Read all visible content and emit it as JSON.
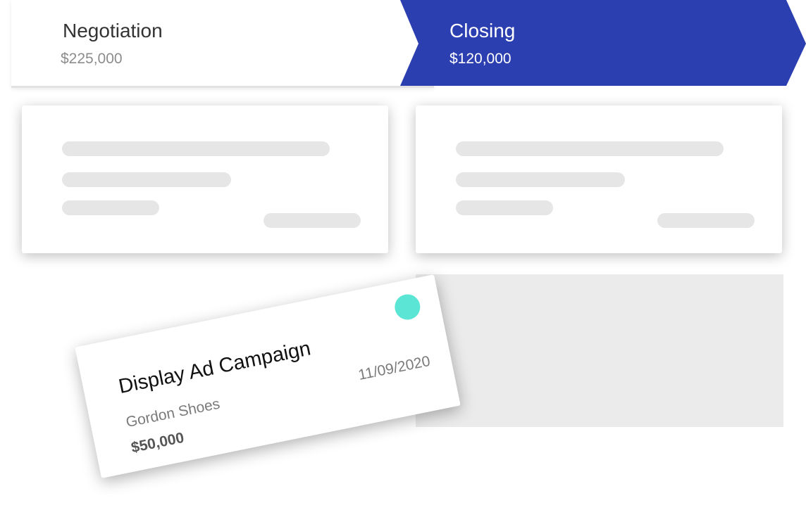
{
  "pipeline": {
    "stages": [
      {
        "name": "Negotiation",
        "amount": "$225,000"
      },
      {
        "name": "Closing",
        "amount": "$120,000"
      }
    ],
    "active_color": "#2c3fb1"
  },
  "deal_card": {
    "title": "Display Ad Campaign",
    "company": "Gordon Shoes",
    "amount": "$50,000",
    "date": "11/09/2020",
    "status_color": "#5be5d4"
  }
}
